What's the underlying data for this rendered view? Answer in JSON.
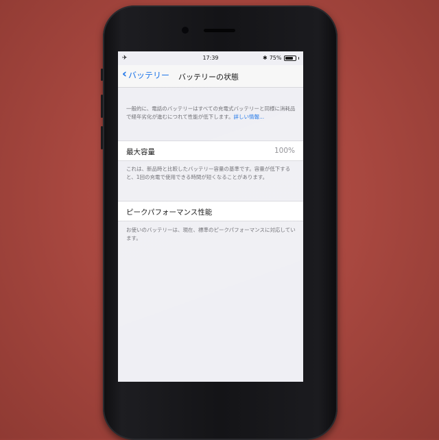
{
  "status_bar": {
    "left_icon": "airplane-icon",
    "left_glyph": "✈",
    "time": "17:39",
    "bluetooth_glyph": "✱",
    "battery_percent": "75%",
    "battery_level": 0.75
  },
  "nav": {
    "back_label": "バッテリー",
    "title": "バッテリーの状態"
  },
  "intro": {
    "text": "一般的に、電話のバッテリーはすべての充電式バッテリーと同様に消耗品で経年劣化が進むにつれて性能が低下します。",
    "link": "詳しい情報..."
  },
  "max_capacity": {
    "label": "最大容量",
    "value": "100%",
    "note": "これは、新品時と比較したバッテリー容量の基準です。容量が低下すると、1回の充電で使用できる時間が短くなることがあります。"
  },
  "peak_performance": {
    "label": "ピークパフォーマンス性能",
    "note": "お使いのバッテリーは、現在、標準のピークパフォーマンスに対応しています。"
  }
}
